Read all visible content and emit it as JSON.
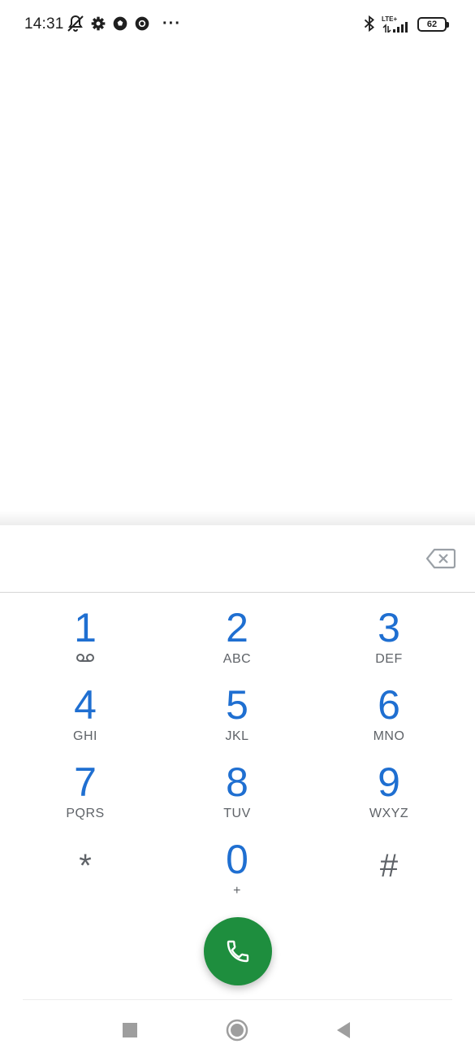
{
  "status_bar": {
    "time": "14:31",
    "icons": [
      "bell-off-icon",
      "gear-icon",
      "soccer-ball-icon",
      "chrome-icon",
      "more-dots-icon",
      "bluetooth-icon",
      "signal-icon",
      "battery-icon"
    ],
    "overflow": "···",
    "network": "LTE+",
    "battery": "62"
  },
  "dialpad": {
    "keys": [
      {
        "digit": "1",
        "letters": ""
      },
      {
        "digit": "2",
        "letters": "ABC"
      },
      {
        "digit": "3",
        "letters": "DEF"
      },
      {
        "digit": "4",
        "letters": "GHI"
      },
      {
        "digit": "5",
        "letters": "JKL"
      },
      {
        "digit": "6",
        "letters": "MNO"
      },
      {
        "digit": "7",
        "letters": "PQRS"
      },
      {
        "digit": "8",
        "letters": "TUV"
      },
      {
        "digit": "9",
        "letters": "WXYZ"
      },
      {
        "digit": "*",
        "letters": ""
      },
      {
        "digit": "0",
        "letters": "+"
      },
      {
        "digit": "#",
        "letters": ""
      }
    ],
    "number_value": "",
    "call_icon": "phone-icon",
    "backspace_icon": "backspace-icon"
  },
  "colors": {
    "digit": "#1f6fd1",
    "call_button": "#1e8e3e",
    "letters": "#5f6368"
  },
  "nav_bar": {
    "buttons": [
      "recents-square-icon",
      "home-circle-icon",
      "back-triangle-icon"
    ]
  }
}
